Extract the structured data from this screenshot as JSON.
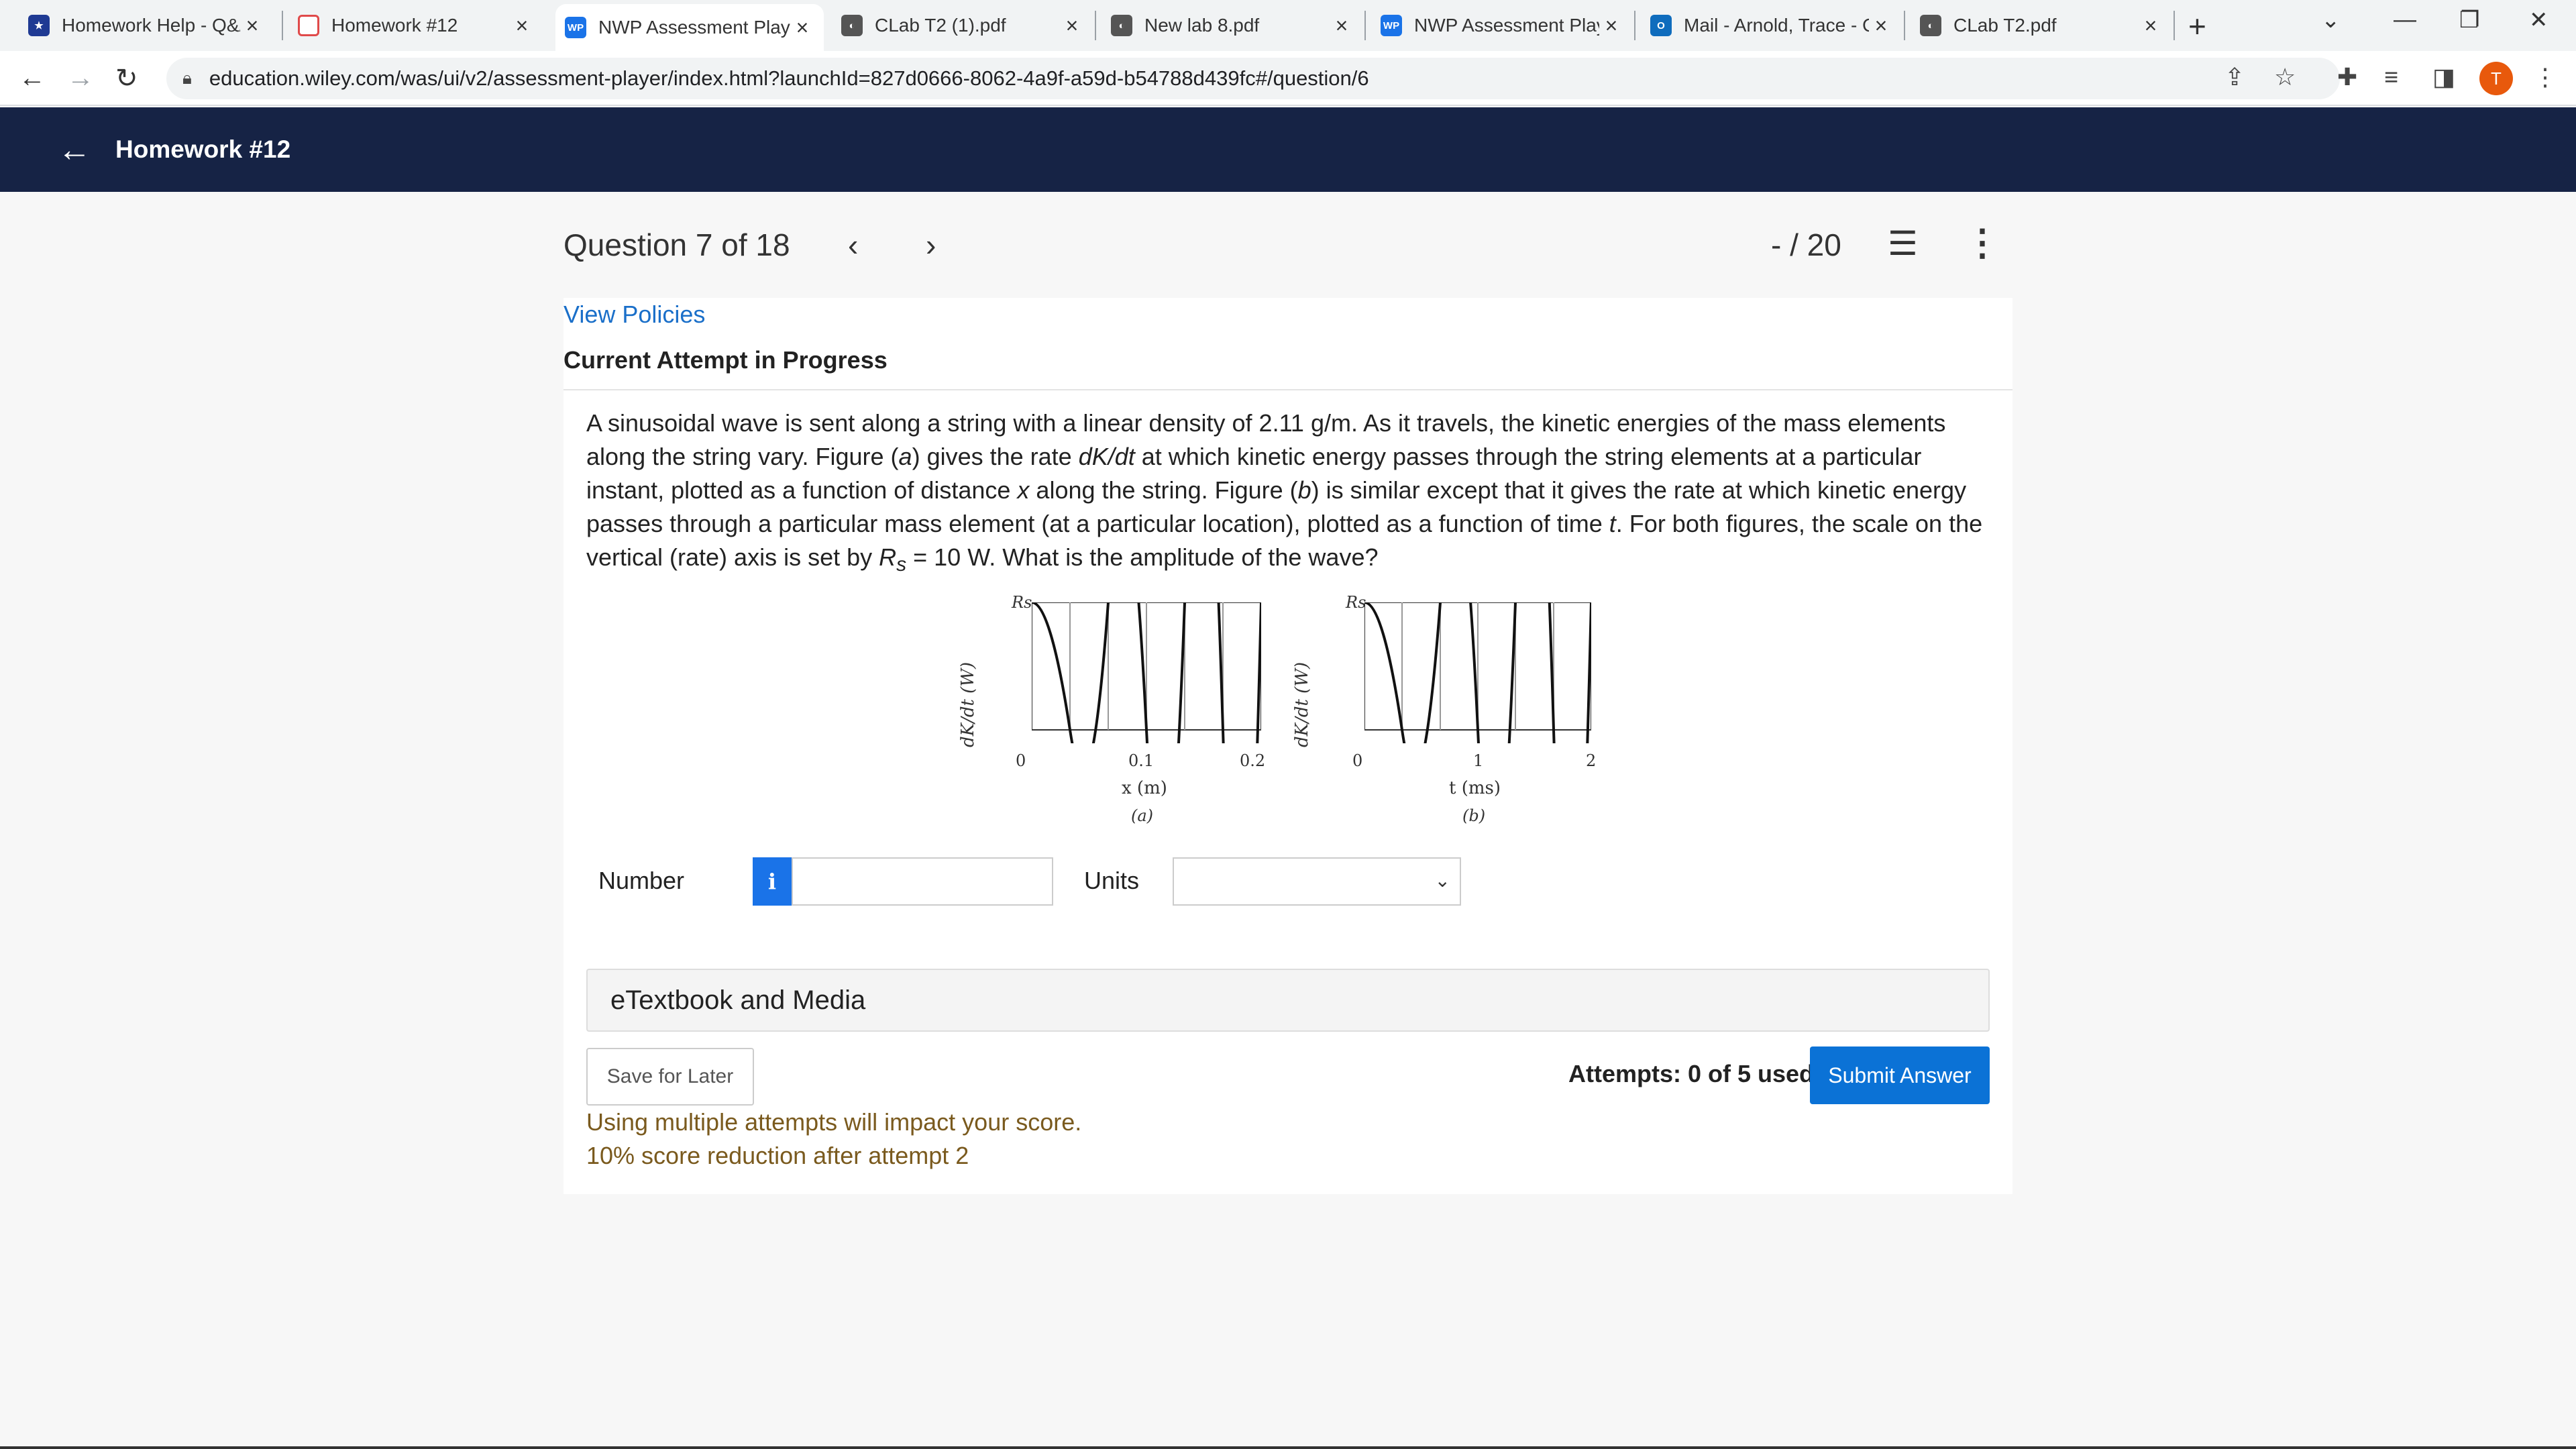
{
  "browser": {
    "tabs": [
      {
        "title": "Homework Help - Q&A",
        "icon": "wiley-icon"
      },
      {
        "title": "Homework #12",
        "icon": "star-seal-icon"
      },
      {
        "title": "NWP Assessment Player",
        "icon": "wp-icon"
      },
      {
        "title": "CLab T2 (1).pdf",
        "icon": "globe-icon"
      },
      {
        "title": "New lab 8.pdf",
        "icon": "globe-icon"
      },
      {
        "title": "NWP Assessment Player",
        "icon": "wp-icon"
      },
      {
        "title": "Mail - Arnold, Trace - Outlook",
        "icon": "mail-icon"
      },
      {
        "title": "CLab T2.pdf",
        "icon": "globe-icon"
      }
    ],
    "active_tab": 2,
    "url": "education.wiley.com/was/ui/v2/assessment-player/index.html?launchId=827d0666-8062-4a9f-a59d-b54788d439fc#/question/6",
    "profile_initial": "T"
  },
  "header": {
    "title": "Homework #12"
  },
  "question_bar": {
    "counter": "Question 7 of 18",
    "score": "- / 20"
  },
  "card": {
    "view_policies": "View Policies",
    "attempt_status": "Current Attempt in Progress",
    "question": {
      "p1": "A sinusoidal wave is sent along a string with a linear density of 2.11 g/m. As it travels, the kinetic energies of the mass elements along the string vary. Figure (",
      "a": "a",
      "p2": ") gives the rate ",
      "dkdt": "dK/dt",
      "p3": " at which kinetic energy passes through the string elements at a particular instant, plotted as a function of distance ",
      "x": "x",
      "p4": " along the string. Figure (",
      "b": "b",
      "p5": ") is similar except that it gives the rate at which kinetic energy passes through a particular mass element (at a particular location), plotted as a function of time ",
      "t": "t",
      "p6": ". For both figures, the scale on the vertical (rate) axis is set by ",
      "rs_r": "R",
      "rs_s": "s",
      "p7": " = 10 W. What is the amplitude of the wave?"
    },
    "figure_a": {
      "ylabel": "dK/dt (W)",
      "rs": "Rs",
      "ticks": [
        "0",
        "0.1",
        "0.2"
      ],
      "xlabel": "x (m)",
      "caption": "(a)"
    },
    "figure_b": {
      "ylabel": "dK/dt (W)",
      "rs": "Rs",
      "ticks": [
        "0",
        "1",
        "2"
      ],
      "xlabel": "t (ms)",
      "caption": "(b)"
    },
    "answer": {
      "number_label": "Number",
      "number_value": "",
      "units_label": "Units",
      "units_value": ""
    },
    "etextbook": "eTextbook and Media",
    "save_later": "Save for Later",
    "attempts": "Attempts: 0 of 5 used",
    "submit": "Submit Answer",
    "warning1": "Using multiple attempts will impact your score.",
    "warning2": "10% score reduction after attempt 2"
  }
}
